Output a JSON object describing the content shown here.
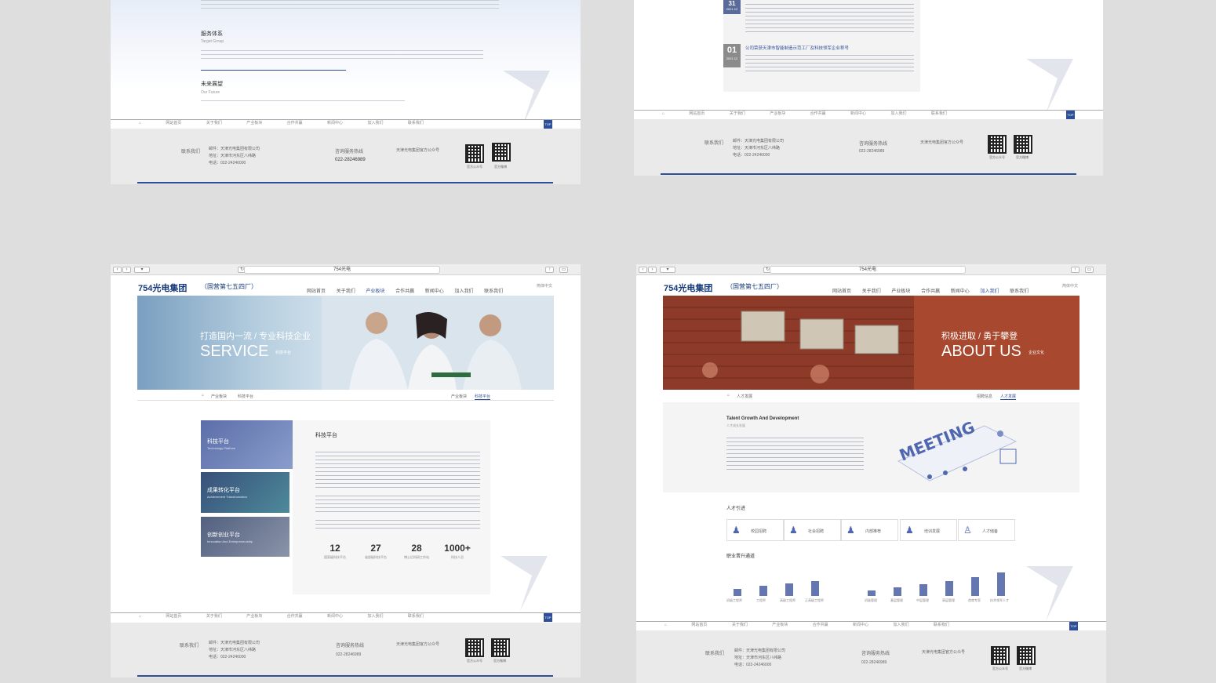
{
  "shared": {
    "url": "754光电",
    "logo": "754光电集团",
    "logo_sub": "（国营第七五四厂）",
    "lang": "简体中文",
    "nav": [
      "网站首页",
      "关于我们",
      "产业板块",
      "合作共赢",
      "新闻中心",
      "加入我们",
      "联系我们"
    ],
    "footer_nav": [
      "网站首页",
      "关于我们",
      "产业板块",
      "合作共赢",
      "新闻中心",
      "加入我们",
      "联系我们"
    ],
    "top": "TOP",
    "contact_title": "联系我们",
    "contact_lines": [
      "邮件：天津光电集团有限公司",
      "地址：天津市河东区八纬路",
      "电话：022-24246000"
    ],
    "hotline_title": "咨询服务热线",
    "hotline": "022-28246989",
    "wechat_title": "天津光电集团官方公众号",
    "qr_labels": [
      "官方公众号",
      "官方微博"
    ]
  },
  "m1": {
    "s1_title": "服务体系",
    "s1_en": "Target Group",
    "s2_title": "未来展望",
    "s2_en": "Our Future"
  },
  "m2": {
    "date_a": "31",
    "date_a_sub": "2021.12",
    "date_b": "01",
    "date_b_sub": "2021.12",
    "news_title": "公司荣获天津市智能制造示范工厂及科技领军企业称号"
  },
  "m3": {
    "hero_cn": "打造国内一流 / 专业科技企业",
    "hero_en": "SERVICE",
    "hero_tag": "科技平台",
    "crumb": [
      "首页",
      "产业板块",
      "科技平台"
    ],
    "tabs": [
      "产业板块",
      "科技平台"
    ],
    "side": [
      "科技平台",
      "成果转化平台",
      "创新创业平台"
    ],
    "side_en": [
      "Technology Platform",
      "Achievement Transformation",
      "Innovation And Entrepreneurship"
    ],
    "panel_title": "科技平台",
    "stats": [
      {
        "n": "12",
        "l": "国家级科技平台"
      },
      {
        "n": "27",
        "l": "省部级科技平台"
      },
      {
        "n": "28",
        "l": "博士后科研工作站"
      },
      {
        "n": "1000+",
        "l": "科技人员"
      }
    ]
  },
  "m4": {
    "hero_cn": "积极进取 / 勇于攀登",
    "hero_en": "ABOUT US",
    "hero_tag": "企业文化",
    "crumb": [
      "首页",
      "人才发展"
    ],
    "tabs": [
      "招聘信息",
      "人才发展"
    ],
    "talent_title": "Talent Growth And Development",
    "talent_sub": "人才成长发展",
    "meeting": "MEETING",
    "section_a": "人才引进",
    "cards": [
      "校园招聘",
      "社会招聘",
      "内部推荐",
      "培训发展",
      "人才储备"
    ],
    "section_b": "职业晋升通道",
    "bars_a": [
      "初级工程师",
      "工程师",
      "高级工程师",
      "正高级工程师"
    ],
    "bars_b": [
      "初级管理",
      "基层管理",
      "中层管理",
      "高层管理",
      "首席专家",
      "技术领军人才"
    ]
  }
}
